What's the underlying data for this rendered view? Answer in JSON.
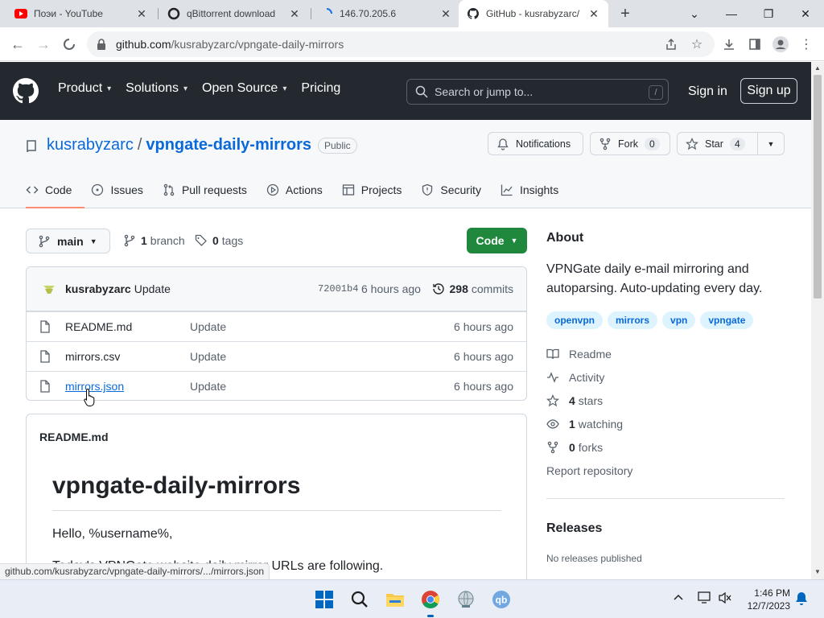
{
  "browser": {
    "tabs": [
      {
        "title": "Поэи - YouTube",
        "icon": "youtube-icon"
      },
      {
        "title": "qBittorrent download",
        "icon": "qbittorrent-icon"
      },
      {
        "title": "146.70.205.6",
        "icon": "loading-icon"
      },
      {
        "title": "GitHub - kusrabyzarc/",
        "icon": "github-icon",
        "active": true
      }
    ],
    "url_host": "github.com",
    "url_path": "/kusrabyzarc/vpngate-daily-mirrors",
    "status_url": "github.com/kusrabyzarc/vpngate-daily-mirrors/.../mirrors.json"
  },
  "gh_header": {
    "nav": [
      "Product",
      "Solutions",
      "Open Source",
      "Pricing"
    ],
    "search_placeholder": "Search or jump to...",
    "slash": "/",
    "sign_in": "Sign in",
    "sign_up": "Sign up"
  },
  "repo": {
    "owner": "kusrabyzarc",
    "sep": "/",
    "name": "vpngate-daily-mirrors",
    "visibility": "Public",
    "notifications": "Notifications",
    "fork_label": "Fork",
    "fork_count": "0",
    "star_label": "Star",
    "star_count": "4",
    "tabs": [
      "Code",
      "Issues",
      "Pull requests",
      "Actions",
      "Projects",
      "Security",
      "Insights"
    ]
  },
  "main": {
    "branch": "main",
    "branch_count": "1",
    "branch_word": "branch",
    "tag_count": "0",
    "tag_word": "tags",
    "code_button": "Code",
    "commit": {
      "author": "kusrabyzarc",
      "message": "Update",
      "sha": "72001b4",
      "time": "6 hours ago",
      "count": "298",
      "count_word": "commits"
    },
    "files": [
      {
        "name": "README.md",
        "message": "Update",
        "time": "6 hours ago"
      },
      {
        "name": "mirrors.csv",
        "message": "Update",
        "time": "6 hours ago"
      },
      {
        "name": "mirrors.json",
        "message": "Update",
        "time": "6 hours ago"
      }
    ],
    "readme": {
      "header": "README.md",
      "h1": "vpngate-daily-mirrors",
      "p1": "Hello, %username%,",
      "p2": "Today's VPNGate website daily mirror URLs are following."
    }
  },
  "about": {
    "heading": "About",
    "description": "VPNGate daily e-mail mirroring and autoparsing. Auto-updating every day.",
    "topics": [
      "openvpn",
      "mirrors",
      "vpn",
      "vpngate"
    ],
    "readme": "Readme",
    "activity": "Activity",
    "stars_count": "4",
    "stars_word": "stars",
    "watching_count": "1",
    "watching_word": "watching",
    "forks_count": "0",
    "forks_word": "forks",
    "report": "Report repository",
    "releases_heading": "Releases",
    "releases_text": "No releases published"
  },
  "taskbar": {
    "time": "1:46 PM",
    "date": "12/7/2023"
  }
}
